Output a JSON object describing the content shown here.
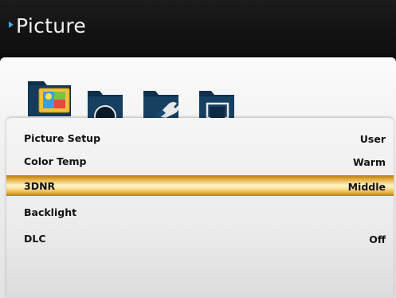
{
  "header": {
    "title": "Picture"
  },
  "icons": [
    {
      "name": "picture-folder-icon",
      "selected": true
    },
    {
      "name": "sound-folder-icon",
      "selected": false
    },
    {
      "name": "setup-folder-icon",
      "selected": false
    },
    {
      "name": "channel-folder-icon",
      "selected": false
    }
  ],
  "menu": {
    "items": [
      {
        "label": "Picture Setup",
        "value": "User"
      },
      {
        "label": "Color Temp",
        "value": "Warm"
      },
      {
        "label": "3DNR",
        "value": "Middle",
        "selected": true
      },
      {
        "label": "Backlight",
        "value": ""
      },
      {
        "label": "DLC",
        "value": "Off"
      }
    ]
  },
  "colors": {
    "header_bg": "#121212",
    "accent_bullet": "#4aa8f0",
    "highlight": "#e2a838",
    "folder_dark": "#10334f"
  }
}
